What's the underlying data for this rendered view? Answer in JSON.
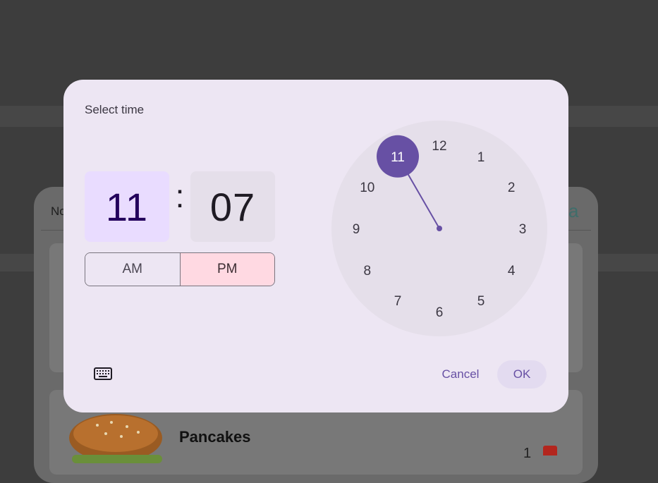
{
  "background": {
    "card_left_text": "No",
    "card_right_text": "a",
    "item_title": "Pancakes",
    "item_quantity": "1",
    "icons": [
      "burger-image",
      "delete-icon"
    ]
  },
  "dialog": {
    "title": "Select time",
    "hour": "11",
    "separator": ":",
    "minute": "07",
    "period": {
      "am_label": "AM",
      "pm_label": "PM",
      "selected": "PM"
    },
    "clock": {
      "numbers": [
        "12",
        "1",
        "2",
        "3",
        "4",
        "5",
        "6",
        "7",
        "8",
        "9",
        "10",
        "11"
      ],
      "selected_hour": "11"
    },
    "keyboard_icon": "keyboard-icon",
    "cancel_label": "Cancel",
    "ok_label": "OK"
  },
  "colors": {
    "scrim": "#3d3d3d",
    "dialog_surface": "#ede6f3",
    "clock_face": "#e5dfea",
    "accent": "#6750a4",
    "hour_selected_bg": "#e9dcff",
    "pm_selected_bg": "#ffd9e2"
  }
}
